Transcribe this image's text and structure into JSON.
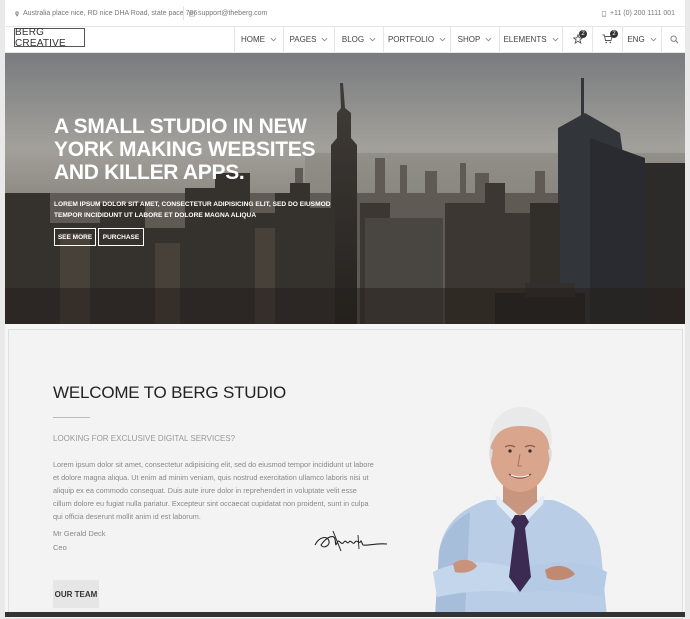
{
  "topbar": {
    "address": "Australia place nice, RD nice DHA Road, state pace 786",
    "email": "support@theberg.com",
    "phone": "+11 (0) 200 1111 001"
  },
  "nav": {
    "logo": "BERG CREATIVE",
    "items": [
      {
        "label": "HOME"
      },
      {
        "label": "PAGES"
      },
      {
        "label": "BLOG"
      },
      {
        "label": "PORTFOLIO"
      },
      {
        "label": "SHOP"
      },
      {
        "label": "ELEMENTS"
      }
    ],
    "wishlist_count": "2",
    "cart_count": "2",
    "language": "ENG"
  },
  "hero": {
    "headline": [
      "A SMALL STUDIO IN NEW",
      "YORK MAKING WEBSITES",
      "AND KILLER APPS."
    ],
    "subtext": [
      "LOREM IPSUM DOLOR SIT AMET, CONSECTETUR ADIPISICING ELIT, SED DO EIUSMOD",
      "TEMPOR INCIDIDUNT UT LABORE ET DOLORE MAGNA ALIQUA"
    ],
    "btn_more": "SEE MORE",
    "btn_purchase": "PURCHASE"
  },
  "welcome": {
    "title": "WELCOME TO BERG STUDIO",
    "question": "LOOKING FOR EXCLUSIVE DIGITAL SERVICES?",
    "paragraph": [
      "Lorem ipsum dolor sit amet, consectetur adipisicing elit, sed do eiusmod tempor incididunt ut labore",
      "et dolore magna aliqua. Ut enim ad minim veniam, quis nostrud exercitation ullamco laboris nisi ut",
      "aliquip ex ea commodo consequat. Duis aute irure dolor in reprehendert in voluptate velit esse",
      "cillum dolore eu fugiat nulla pariatur. Excepteur sint occaecat cupidatat non proident, sunt in culpa",
      "qui officia deserunt mollit anim id est laborum."
    ],
    "name": "Mr Gerald Deck",
    "role": "Ceo",
    "team_button": "OUR TEAM"
  },
  "colors": {
    "text_dark": "#222222",
    "muted": "#888888",
    "border": "#e6e6e6"
  }
}
